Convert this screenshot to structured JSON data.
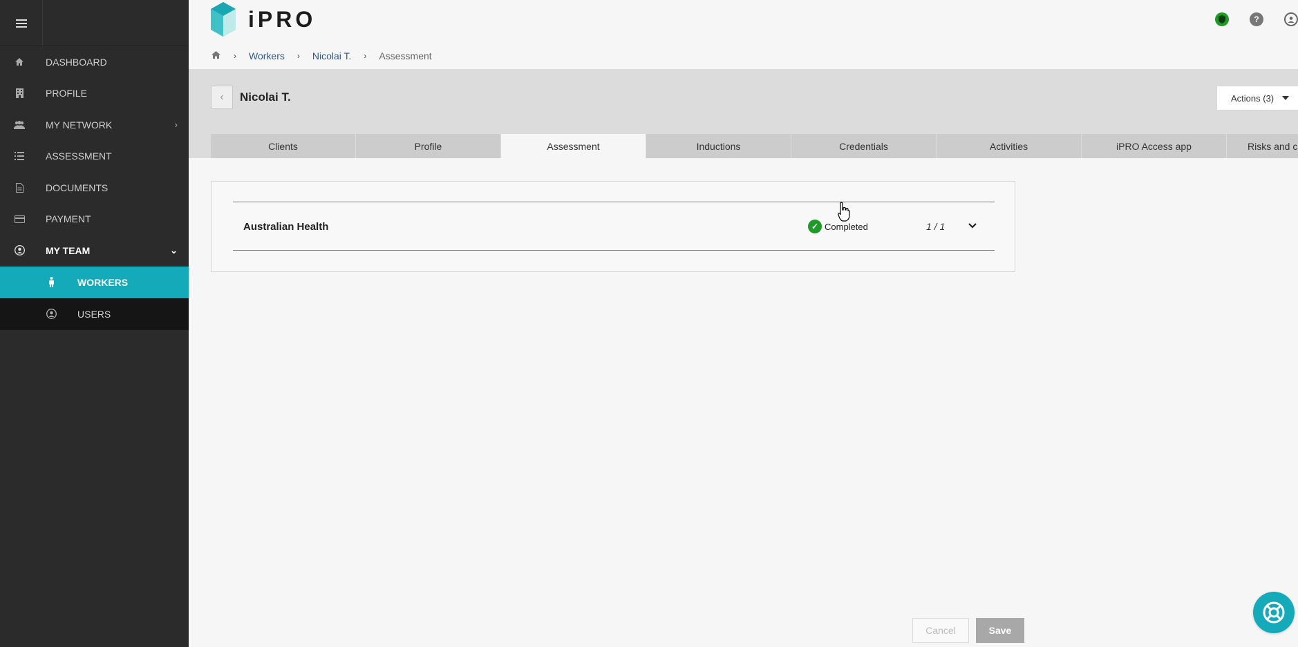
{
  "app": {
    "logo_text": "iPRO"
  },
  "colors": {
    "accent": "#15aab9",
    "sidebar_bg": "#2b2b2b",
    "success": "#1f9a27",
    "link": "#2d5a8c"
  },
  "sidebar": {
    "menu_icon": "hamburger-icon",
    "items": [
      {
        "label": "DASHBOARD",
        "icon": "home-icon"
      },
      {
        "label": "PROFILE",
        "icon": "building-icon"
      },
      {
        "label": "MY NETWORK",
        "icon": "users-icon",
        "has_chevron": true
      },
      {
        "label": "ASSESSMENT",
        "icon": "list-icon"
      },
      {
        "label": "DOCUMENTS",
        "icon": "document-icon"
      },
      {
        "label": "PAYMENT",
        "icon": "credit-card-icon"
      },
      {
        "label": "MY TEAM",
        "icon": "user-circle-icon",
        "expanded": true
      }
    ],
    "subitems": [
      {
        "label": "WORKERS",
        "icon": "person-icon",
        "active": true
      },
      {
        "label": "USERS",
        "icon": "user-circle-icon"
      }
    ]
  },
  "header": {
    "icons": [
      "shield-icon",
      "help-icon",
      "account-icon"
    ]
  },
  "breadcrumb": {
    "home_icon": "home-icon",
    "items": [
      "Workers",
      "Nicolai T.",
      "Assessment"
    ]
  },
  "worker": {
    "name": "Nicolai T.",
    "actions_label": "Actions (3)"
  },
  "tabs": [
    "Clients",
    "Profile",
    "Assessment",
    "Inductions",
    "Credentials",
    "Activities",
    "iPRO Access app",
    "Risks and c"
  ],
  "active_tab": "Assessment",
  "assessment": {
    "title": "Australian Health",
    "status": "Completed",
    "count": "1 / 1"
  },
  "footer": {
    "cancel_label": "Cancel",
    "save_label": "Save"
  }
}
